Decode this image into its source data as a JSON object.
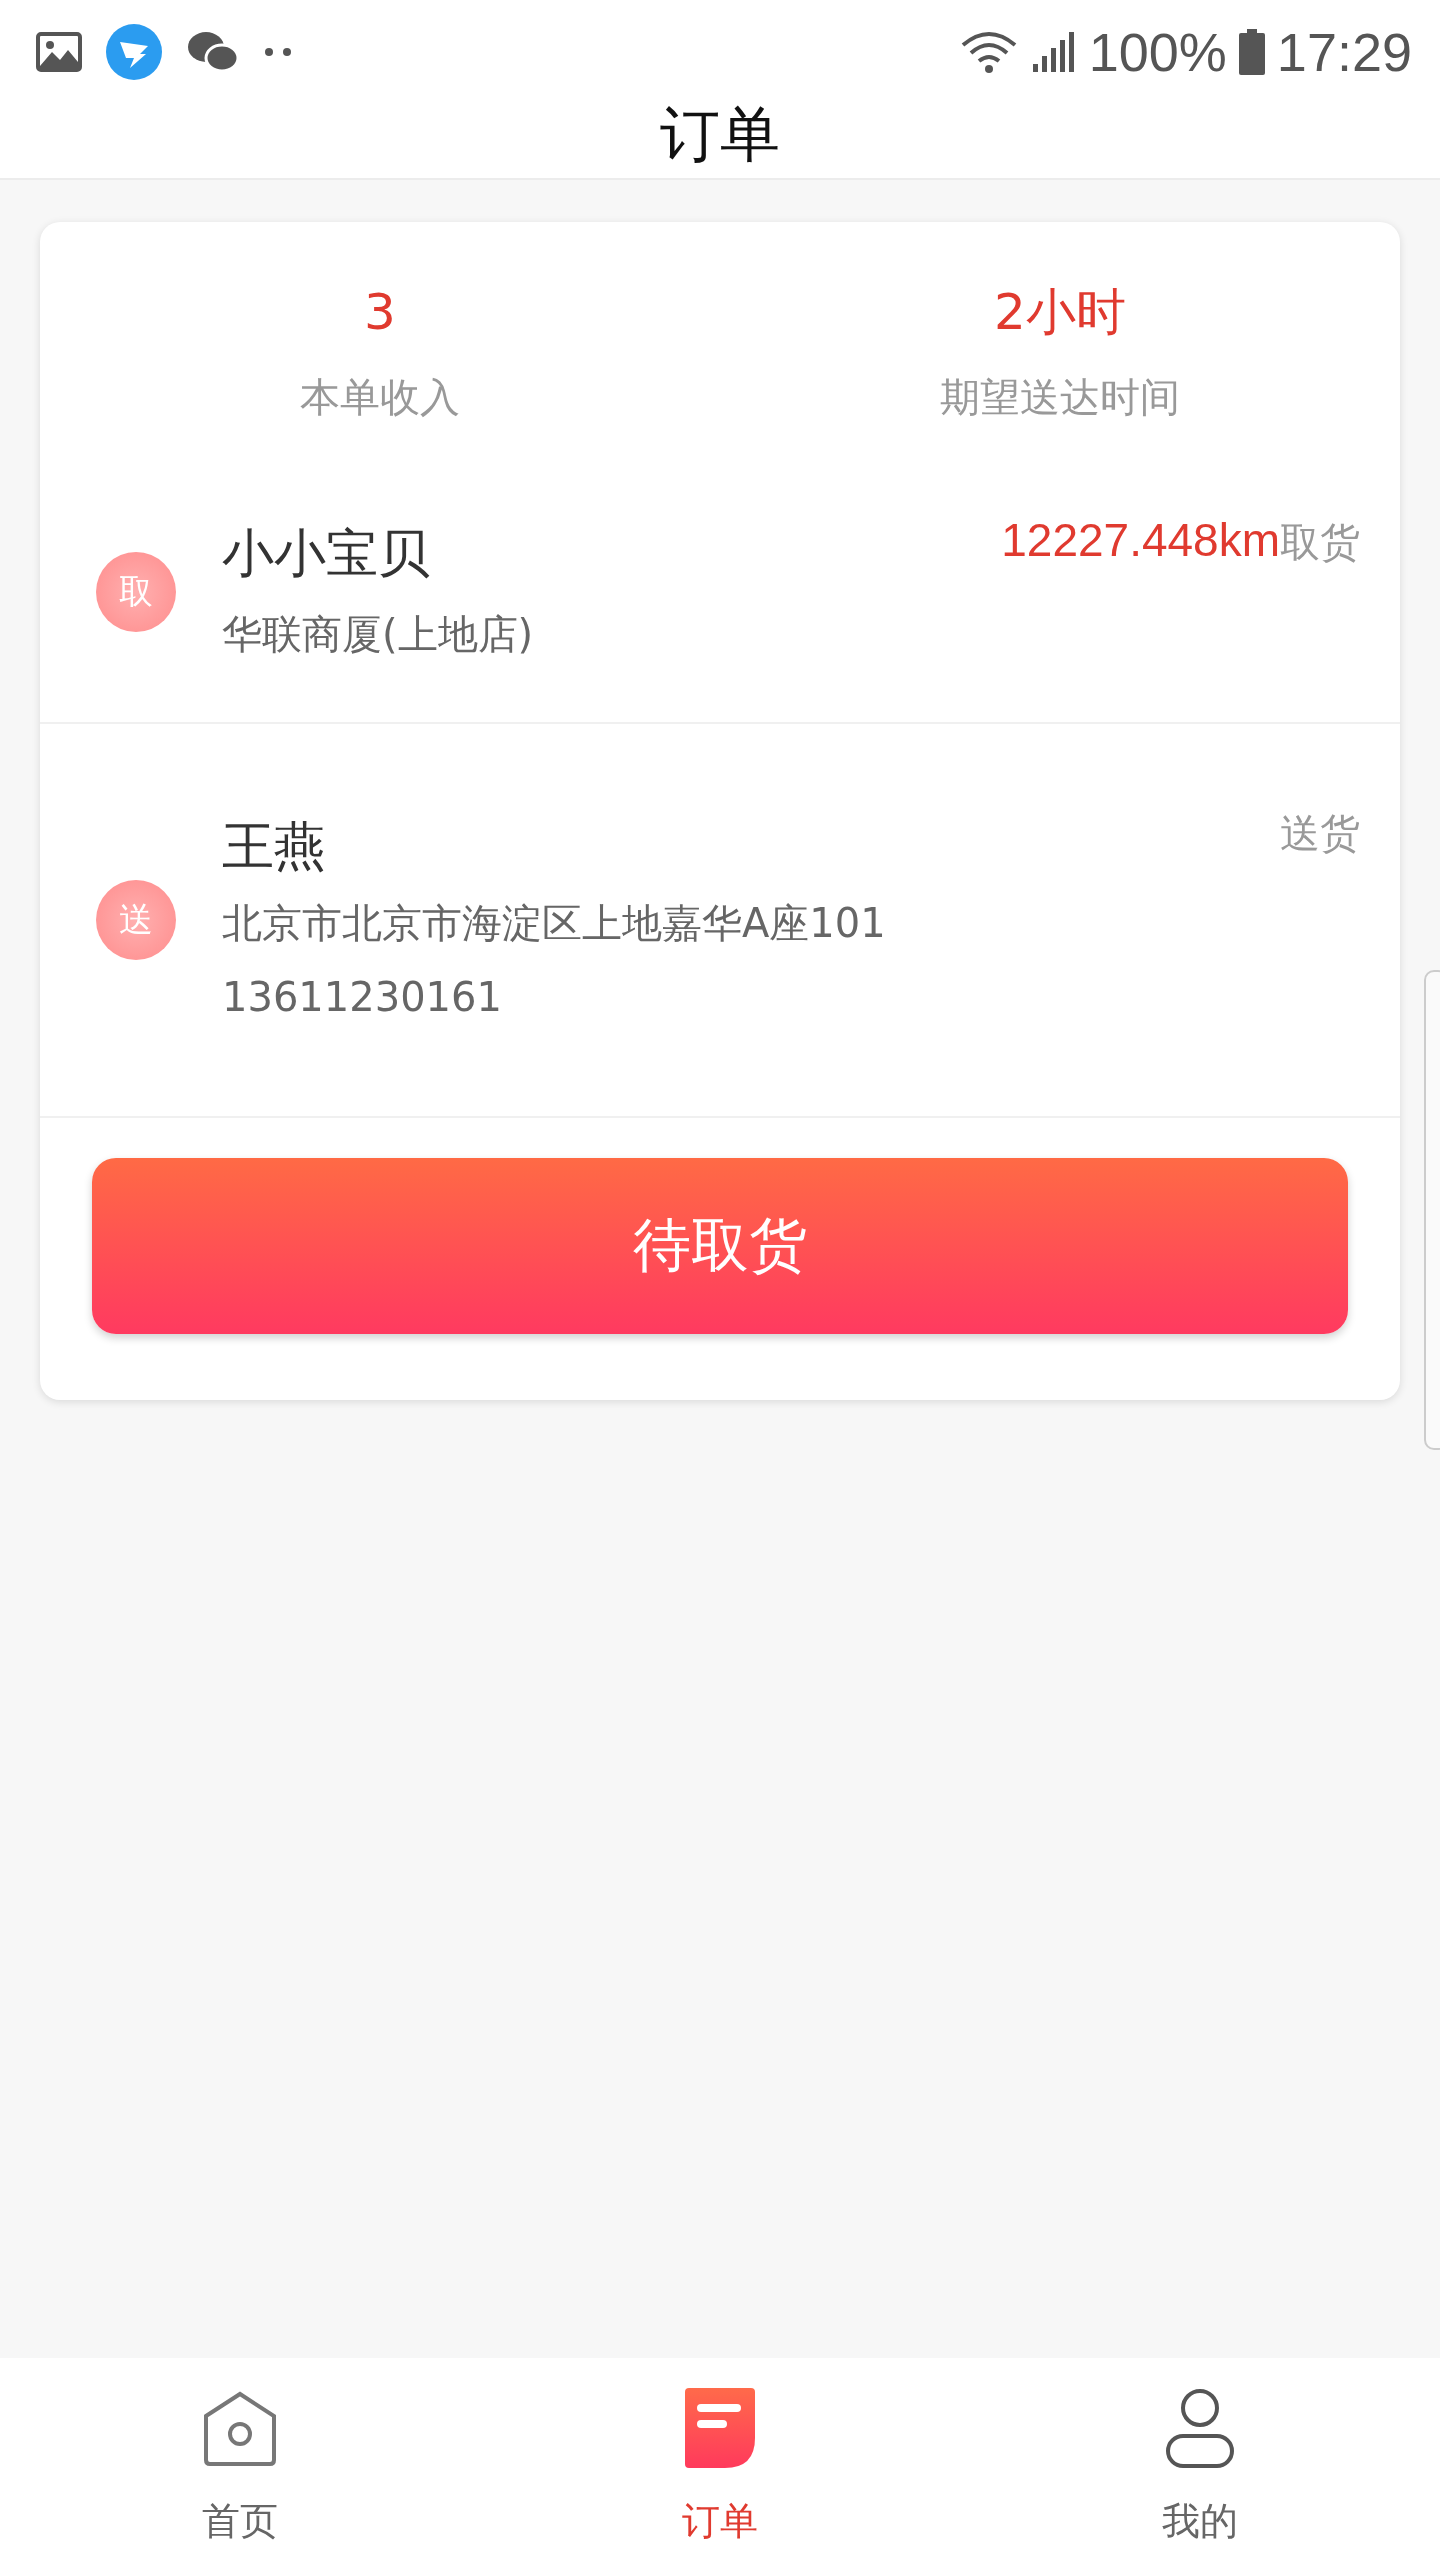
{
  "status_bar": {
    "battery": "100%",
    "time": "17:29"
  },
  "header": {
    "title": "订单"
  },
  "summary": [
    {
      "value": "3",
      "label": "本单收入"
    },
    {
      "value": "2小时",
      "label": "期望送达时间"
    }
  ],
  "stops": [
    {
      "kind": "pickup",
      "badge": "取",
      "name": "小小宝贝",
      "distance": "12227.448km",
      "action": "取货",
      "lines": [
        "华联商厦(上地店)"
      ]
    },
    {
      "kind": "delivery",
      "badge": "送",
      "name": "王燕",
      "action": "送货",
      "lines": [
        "北京市北京市海淀区上地嘉华A座101",
        "13611230161"
      ]
    }
  ],
  "primary_button": "待取货",
  "tabs": [
    {
      "label": "首页",
      "selected": false,
      "kind": "home"
    },
    {
      "label": "订单",
      "selected": true,
      "kind": "orders"
    },
    {
      "label": "我的",
      "selected": false,
      "kind": "profile"
    }
  ]
}
